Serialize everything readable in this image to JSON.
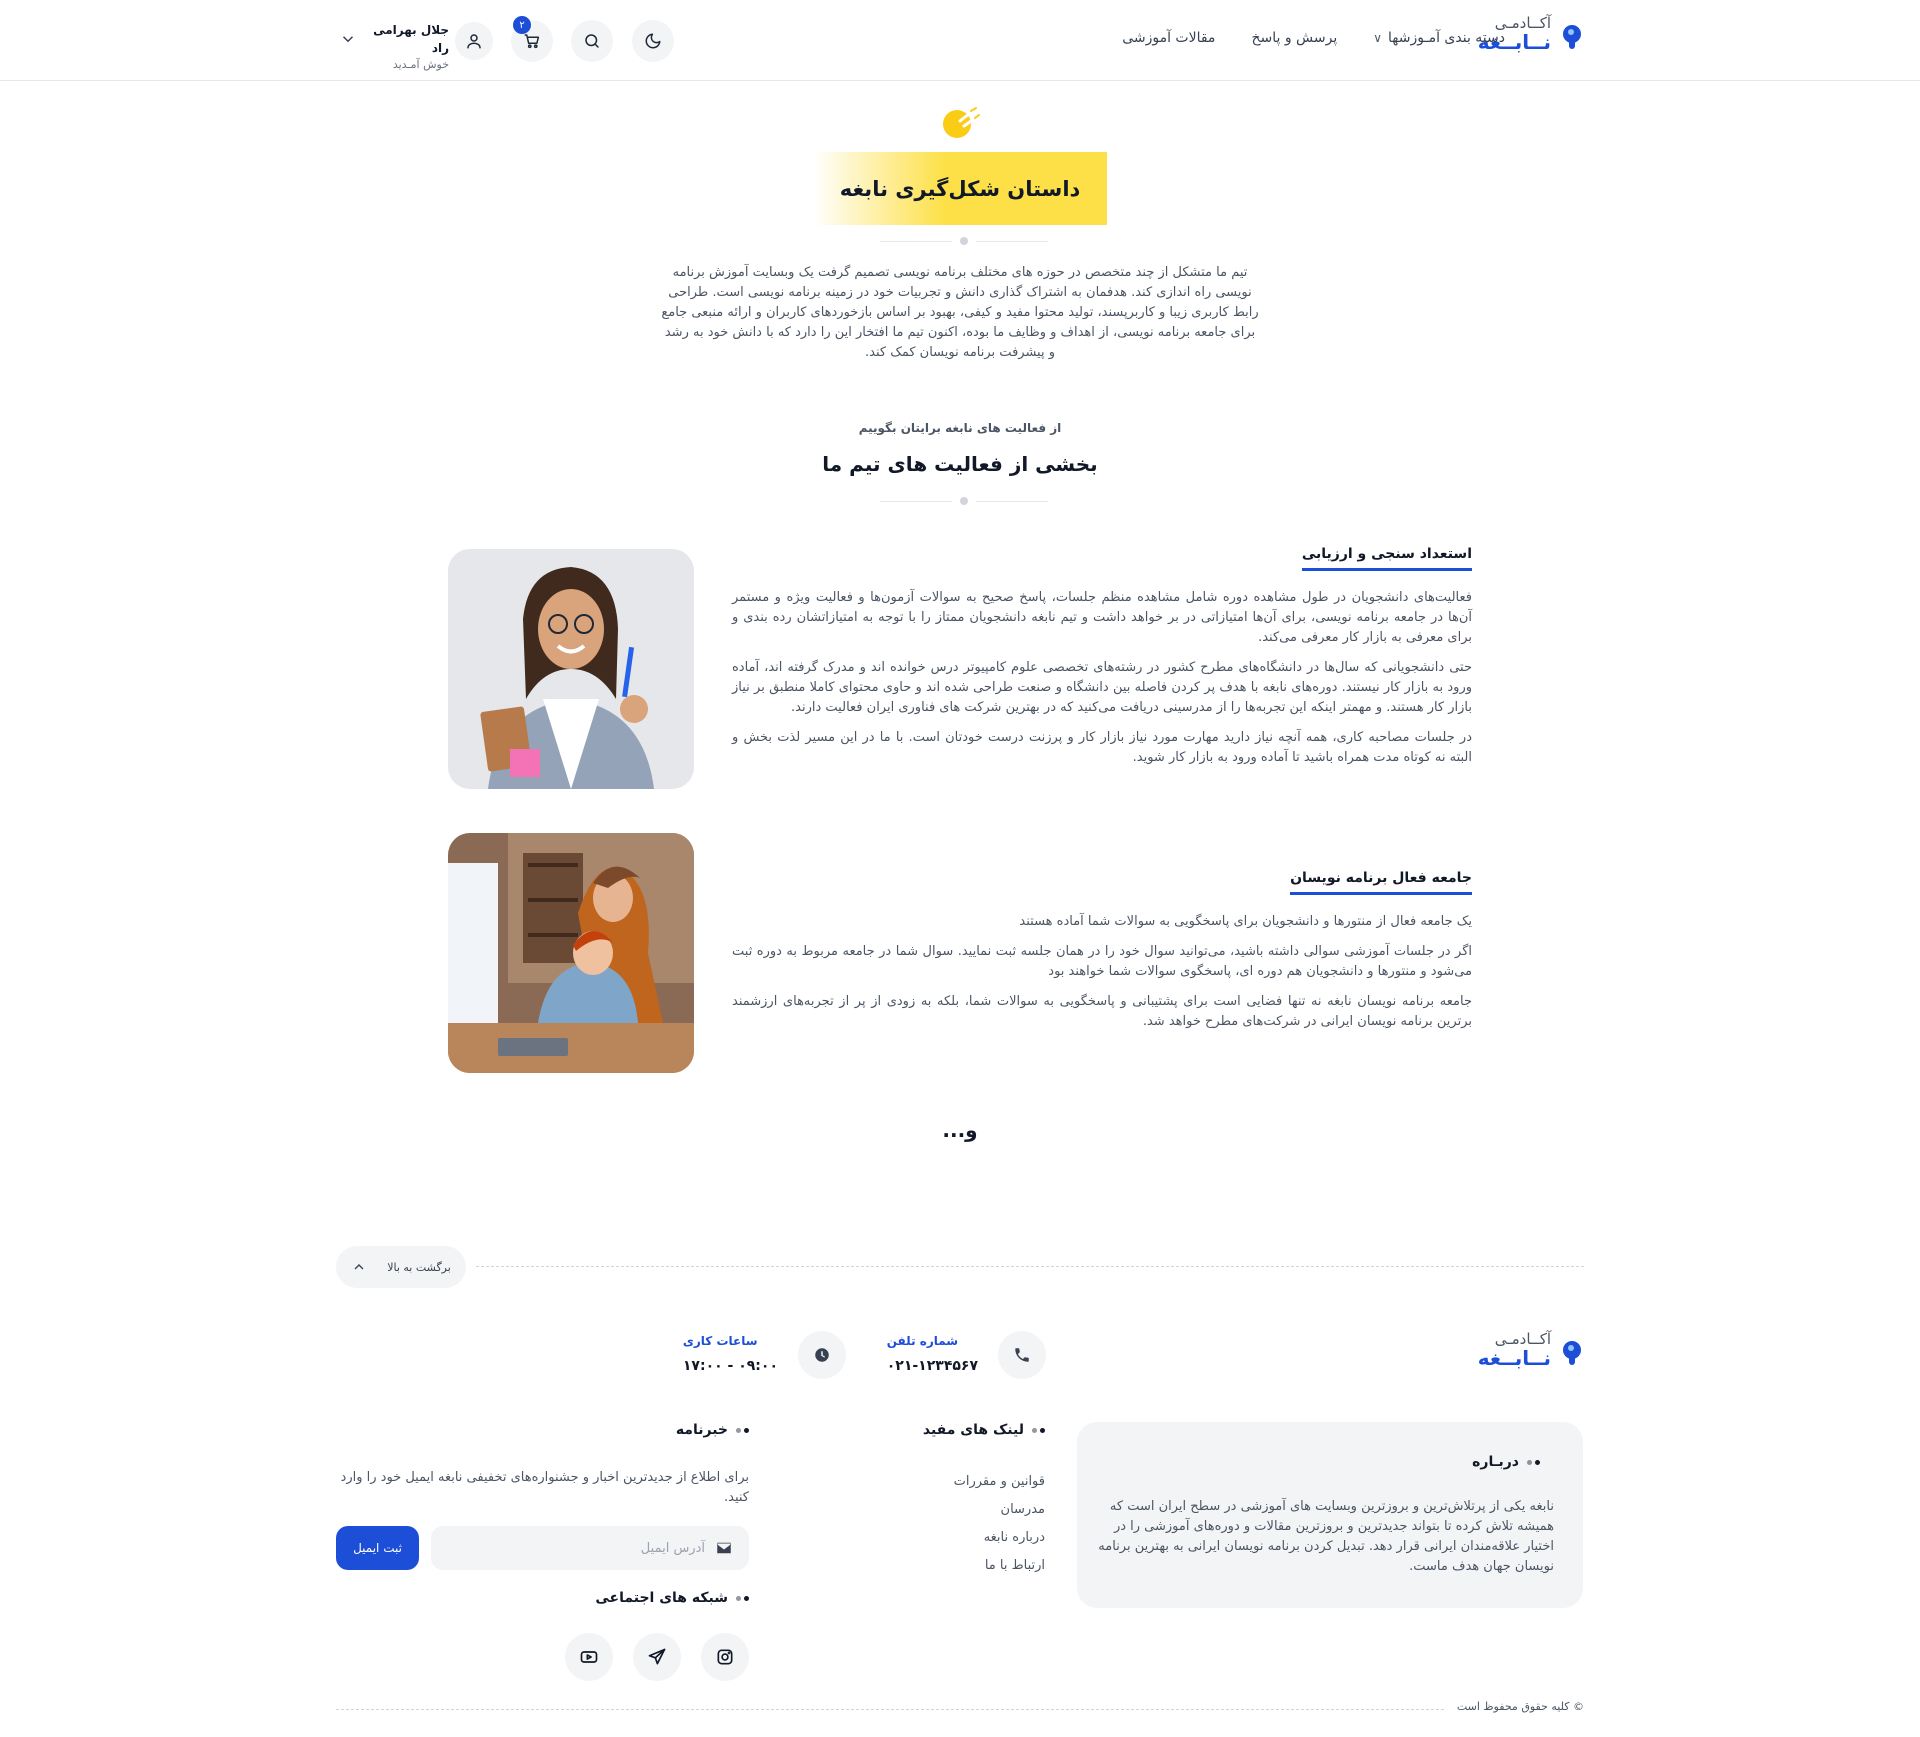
{
  "brand": {
    "top": "آکــادمـی",
    "bottom": "نــابــغه",
    "accent": "#1d4ed8"
  },
  "nav": {
    "articles": "مقالات آموزشی",
    "qa": "پرسش و پاسخ",
    "categories": "دسته بندی آمـوزشها"
  },
  "header": {
    "cart_count": "۲",
    "user_name": "جلال بهرامی راد",
    "welcome": "خوش آمـدید"
  },
  "story": {
    "title": "داستان شکل‌گیری نابغه",
    "highlight": "#fde047",
    "text": "تیم ما متشکل از چند متخصص در حوزه های مختلف برنامه نویسی تصمیم گرفت یک وبسایت آموزش برنامه نویسی راه اندازی کند. هدفمان به اشتراک گذاری دانش و تجربیات خود در زمینه برنامه نویسی است. طراحی رابط کاربری زیبا و کاربرپسند، تولید محتوا مفید و کیفی، بهبود بر اساس بازخوردهای کاربران و ارائه منبعی جامع برای جامعه برنامه نویسی، از اهداف و وظایف ما بوده، اکنون تیم ما افتخار این را دارد که با دانش خود به رشد و پیشرفت برنامه نویسان کمک کند."
  },
  "activities": {
    "sub_label": "از فعالیت های نابغه برایتان بگوییم",
    "title": "بخشی از فعالیت های تیم ما",
    "items": [
      {
        "title": "استعداد سنجی و ارزیابی",
        "image": "student-woman-photo",
        "paragraphs": [
          "فعالیت‌های دانشجویان در طول مشاهده دوره شامل مشاهده منظم جلسات، پاسخ صحیح به سوالات آزمون‌ها و فعالیت ویژه و مستمر آن‌ها در جامعه برنامه نویسی، برای آن‌ها امتیازاتی در بر خواهد داشت و تیم نابغه دانشجویان ممتاز را با توجه به امتیازاتشان رده بندی و برای معرفی به بازار کار معرفی می‌کند.",
          "حتی دانشجویانی که سال‌ها در دانشگاه‌های مطرح کشور در رشته‌های تخصصی علوم کامپیوتر درس خوانده اند و مدرک گرفته اند، آماده ورود به بازار کار نیستند. دوره‌های نابغه با هدف پر کردن فاصله بین دانشگاه و صنعت طراحی شده اند و حاوی محتوای کاملا منطبق بر نیاز بازار کار هستند. و مهمتر اینکه این تجربه‌ها را از مدرسینی دریافت می‌کنید که در بهترین شرکت های فناوری ایران فعالیت دارند.",
          "در جلسات مصاحبه کاری، همه آنچه نیاز دارید مهارت مورد نیاز بازار کار و پرزنت درست خودتان است. با ما در این مسیر لذت بخش و البته نه کوتاه مدت همراه باشید تا آماده ورود به بازار کار شوید."
        ]
      },
      {
        "title": "جامعه فعال برنامه نویسان",
        "image": "mother-child-computer-photo",
        "paragraphs": [
          "یک جامعه فعال از منتورها و دانشجویان برای پاسخگویی به سوالات شما آماده هستند",
          "اگر در جلسات آموزشی سوالی داشته باشید، می‌توانید سوال خود را در همان جلسه ثبت نمایید. سوال شما در جامعه مربوط به دوره ثبت می‌شود و منتورها و دانشجویان هم دوره ای، پاسخگوی سوالات شما خواهند بود",
          "جامعه برنامه نویسان نابغه نه تنها فضایی است برای پشتیبانی و پاسخگویی به سوالات شما، بلکه به زودی از پر از تجربه‌های ارزشمند برترین برنامه نویسان ایرانی در شرکت‌های مطرح خواهد شد."
        ]
      }
    ],
    "and_more": "و..."
  },
  "footer": {
    "back_to_top": "برگشت به بالا",
    "phone_label": "شماره تلفن",
    "phone_value": "۰۲۱-۱۲۳۴۵۶۷",
    "hours_label": "ساعات کاری",
    "hours_value": "۰۹:۰۰ - ۱۷:۰۰",
    "about_title": "دربـاره",
    "about_text": "نابغه یکی از پرتلاش‌ترین و بروزترین وبسایت های آموزشی در سطح ایران است که همیشه تلاش کرده تا بتواند جدیدترین و بروزترین مقالات و دوره‌های آموزشی را در اختیار علاقه‌مندان ایرانی قرار دهد. تبدیل کردن برنامه نویسان ایرانی به بهترین برنامه نویسان جهان هدف ماست.",
    "links_title": "لینک های مفید",
    "links": [
      "قوانین و مقررات",
      "مدرسان",
      "درباره نابغه",
      "ارتباط با ما"
    ],
    "news_title": "خبرنامه",
    "news_text": "برای اطلاع از جدیدترین اخبار و جشنواره‌های تخفیفی نابغه ایمیل خود را وارد کنید.",
    "email_placeholder": "آدرس ایمیل",
    "email_button": "ثبت ایمیل",
    "social_title": "شبکه های اجتماعی",
    "socials": [
      "instagram-icon",
      "telegram-icon",
      "youtube-icon"
    ],
    "copyright": "© کلیه حقوق محفوظ است"
  }
}
